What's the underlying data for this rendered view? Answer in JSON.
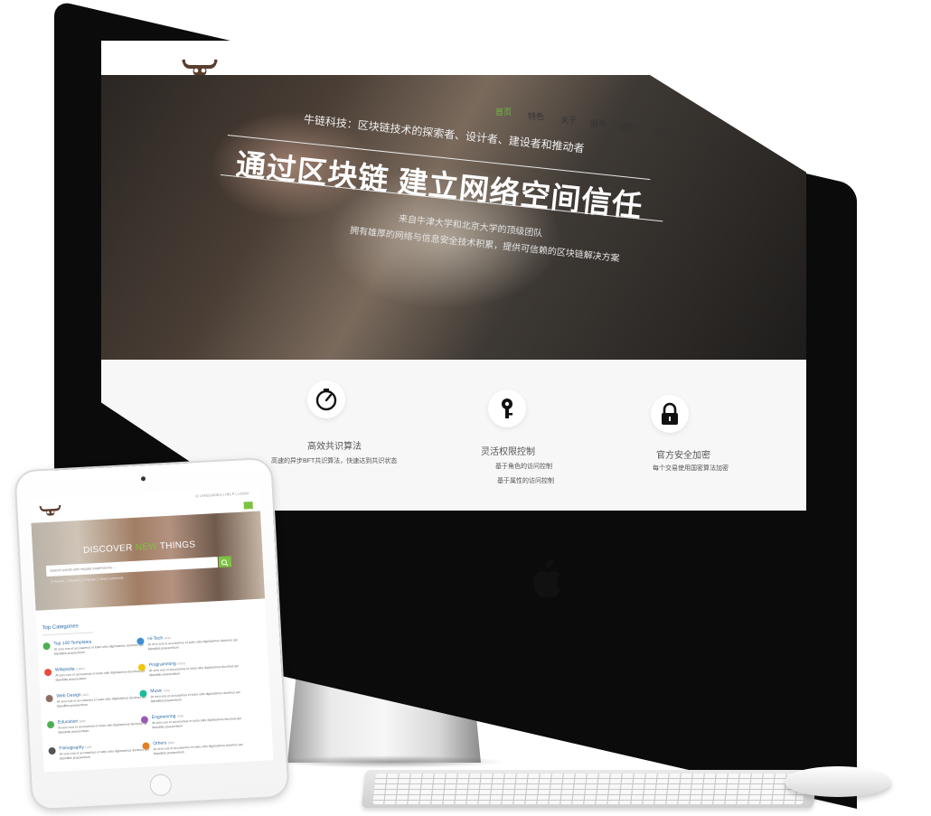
{
  "imac": {
    "nav": [
      {
        "label": "首页",
        "active": true
      },
      {
        "label": "特色",
        "active": false
      },
      {
        "label": "关于",
        "active": false
      },
      {
        "label": "服务",
        "active": false
      },
      {
        "label": "团队",
        "active": false
      },
      {
        "label": "联系",
        "active": false
      }
    ],
    "hero": {
      "subtitle": "牛链科技：区块链技术的探索者、设计者、建设者和推动者",
      "title": "通过区块链 建立网络空间信任",
      "desc_1": "来自牛津大学和北京大学的顶级团队",
      "desc_2": "拥有雄厚的网络与信息安全技术积累，提供可信赖的区块链解决方案"
    },
    "features": [
      {
        "icon": "speedometer-icon",
        "title": "高效共识算法",
        "desc": [
          "高速的异步BFT共识算法，快速达到共识状态"
        ]
      },
      {
        "icon": "key-icon",
        "title": "灵活权限控制",
        "desc": [
          "基于角色的访问控制",
          "基于属性的访问控制"
        ]
      },
      {
        "icon": "lock-icon",
        "title": "官方安全加密",
        "desc": [
          "每个交易使用国密算法加密"
        ]
      }
    ],
    "accent_color": "#6bbf3b"
  },
  "ipad": {
    "top_links": "◎ LANGUAGES  |  HELP  |  LOGIN",
    "hero": {
      "discover_1": "DISCOVER ",
      "discover_2": "NEW",
      "discover_3": " THINGS",
      "search_placeholder": "Search words with regular expressions ...",
      "checks": "▢ Recent     ▢ Related     ▢ Popular     ▢ Most Comments"
    },
    "categories_title": "Top Categories",
    "categories": [
      {
        "name": "Top 100 Templates",
        "count": "",
        "color": "#4caf50",
        "desc": "At vero eos et accusamus et iusto odio dignissimos ducimus qui blanditiis praesentium"
      },
      {
        "name": "Hi-Tech",
        "count": "(326)",
        "color": "#3f8fd2",
        "desc": "At vero eos et accusamus et iusto odio dignissimos ducimus qui blanditiis praesentium"
      },
      {
        "name": "Wikipedia",
        "count": "(13837)",
        "color": "#e74c3c",
        "desc": "At vero eos et accusamus et iusto odio dignissimos ducimus qui blanditiis praesentium"
      },
      {
        "name": "Programming",
        "count": "(4010)",
        "color": "#f1c40f",
        "desc": "At vero eos et accusamus et iusto odio dignissimos ducimus qui blanditiis praesentium"
      },
      {
        "name": "Web Design",
        "count": "(442)",
        "color": "#8d6e63",
        "desc": "At vero eos et accusamus et iusto odio dignissimos ducimus qui blanditiis praesentium"
      },
      {
        "name": "Music",
        "count": "(103)",
        "color": "#1abc9c",
        "desc": "At vero eos et accusamus et iusto odio dignissimos ducimus qui blanditiis praesentium"
      },
      {
        "name": "Education",
        "count": "(536)",
        "color": "#4caf50",
        "desc": "At vero eos et accusamus et iusto odio dignissimos ducimus qui blanditiis praesentium"
      },
      {
        "name": "Engineering",
        "count": "(759)",
        "color": "#9b59b6",
        "desc": "At vero eos et accusamus et iusto odio dignissimos ducimus qui blanditiis praesentium"
      },
      {
        "name": "Filmography",
        "count": "(156)",
        "color": "#555555",
        "desc": "At vero eos et accusamus et iusto odio dignissimos ducimus qui blanditiis praesentium"
      },
      {
        "name": "Others",
        "count": "(256)",
        "color": "#e67e22",
        "desc": "At vero eos et accusamus et iusto odio dignissimos ducimus qui blanditiis praesentium"
      }
    ],
    "accent_color": "#7cc242"
  }
}
